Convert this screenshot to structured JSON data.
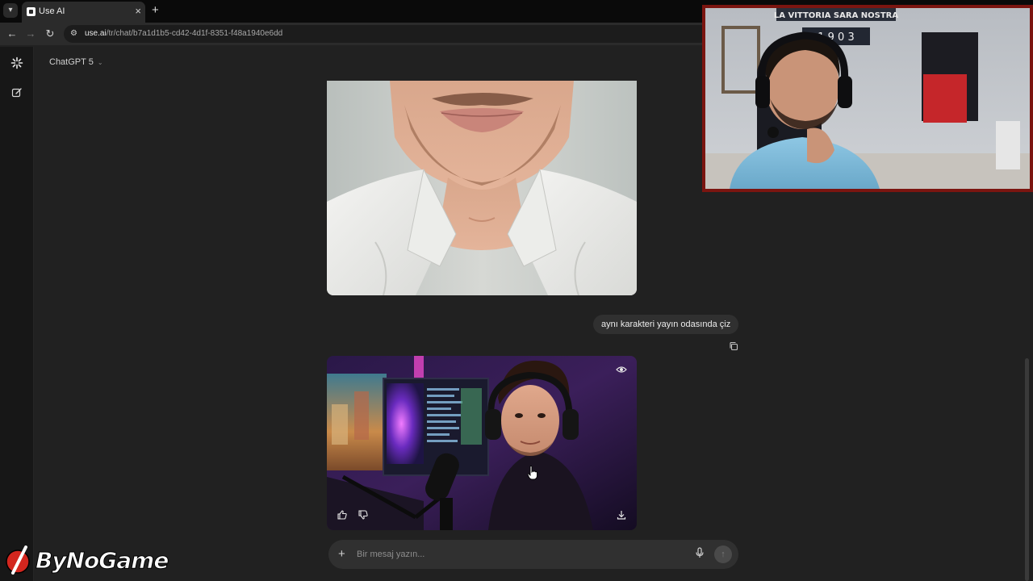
{
  "browser": {
    "tab": {
      "title": "Use AI"
    },
    "address": {
      "host": "use.ai",
      "path": "/tr/chat/b7a1d1b5-cd42-4d1f-8351-f48a1940e6dd"
    }
  },
  "app": {
    "model_selector": {
      "label": "ChatGPT 5"
    },
    "messages": [
      {
        "role": "assistant",
        "type": "image",
        "subject": "generated portrait - man in white shirt (cropped, lower face)"
      },
      {
        "role": "user",
        "text": "aynı karakteri yayın odasında çiz"
      },
      {
        "role": "assistant",
        "type": "image",
        "subject": "generated illustration - man with headphones in streaming room"
      }
    ],
    "composer": {
      "placeholder": "Bir mesaj yazın..."
    }
  },
  "overlay": {
    "webcam_poster_text": "LA VITTORIA SARA NOSTRA",
    "webcam_poster_digits": "1 9 0 3",
    "watermark": "ByNoGame"
  },
  "icons": {
    "sidebar_top": "sparkle-logo-icon",
    "sidebar_new": "new-chat-icon",
    "copy": "copy-icon",
    "eye": "eye-icon",
    "thumbs_up": "thumbs-up-icon",
    "thumbs_down": "thumbs-down-icon",
    "download": "download-icon",
    "mic": "microphone-icon",
    "send": "send-arrow-icon"
  }
}
